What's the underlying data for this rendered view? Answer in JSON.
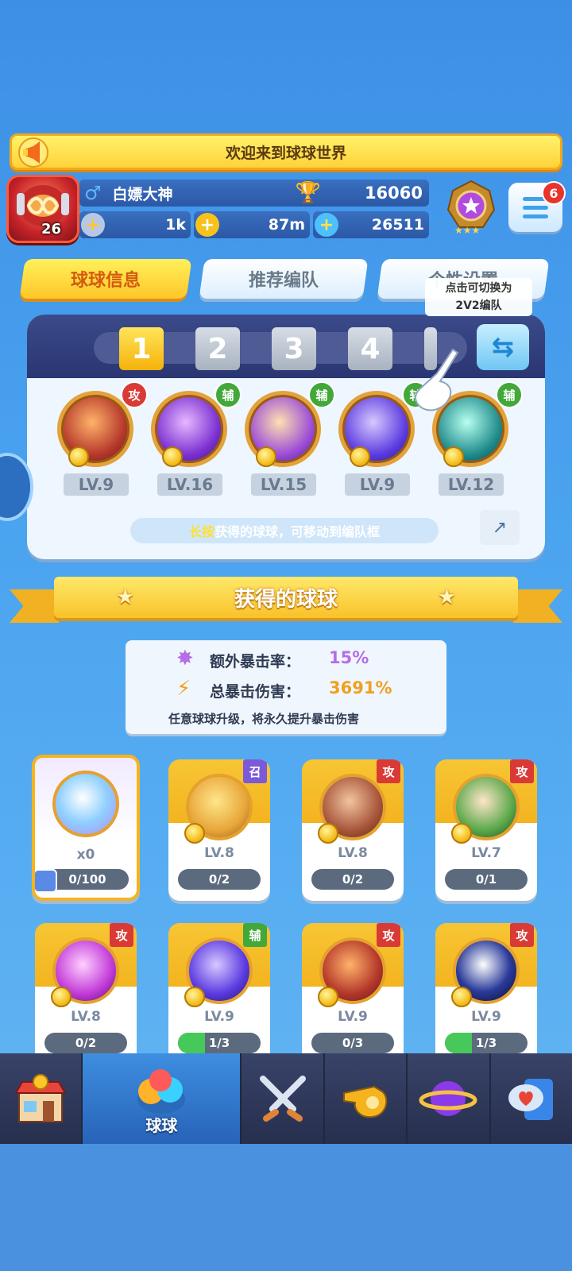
{
  "banner": {
    "text": "欢迎来到球球世界"
  },
  "player": {
    "level": "26",
    "name": "白嫖大神",
    "trophies": "16060",
    "energy": "1k",
    "coins": "87m",
    "gems": "26511",
    "notifications": "6"
  },
  "tabs": [
    {
      "label": "球球信息",
      "active": true
    },
    {
      "label": "推荐编队",
      "active": false
    },
    {
      "label": "个性设置",
      "active": false
    }
  ],
  "tooltip": {
    "line1": "点击可切换为",
    "line2": "2V2编队"
  },
  "team": {
    "slots": [
      "1",
      "2",
      "3",
      "4"
    ],
    "balls": [
      {
        "role": "攻",
        "level": "LV.9"
      },
      {
        "role": "辅",
        "level": "LV.16"
      },
      {
        "role": "辅",
        "level": "LV.15"
      },
      {
        "role": "辅",
        "level": "LV.9"
      },
      {
        "role": "辅",
        "level": "LV.12"
      }
    ],
    "hint_em": "长按",
    "hint_rest": "获得的球球，可移动到编队框"
  },
  "section": {
    "title": "获得的球球"
  },
  "crit": {
    "extra_label": "额外暴击率：",
    "extra_value": "15%",
    "total_label": "总暴击伤害：",
    "total_value": "3691%",
    "note": "任意球球升级，将永久提升暴击伤害"
  },
  "cards": [
    {
      "special": true,
      "count": "x0",
      "progress": "0/100"
    },
    {
      "role": "召",
      "level": "LV.8",
      "progress": "0/2"
    },
    {
      "role": "攻",
      "level": "LV.8",
      "progress": "0/2"
    },
    {
      "role": "攻",
      "level": "LV.7",
      "progress": "0/1"
    },
    {
      "role": "攻",
      "level": "LV.8",
      "progress": "0/2"
    },
    {
      "role": "辅",
      "level": "LV.9",
      "progress": "1/3"
    },
    {
      "role": "攻",
      "level": "LV.9",
      "progress": "0/3"
    },
    {
      "role": "攻",
      "level": "LV.9",
      "progress": "1/3"
    }
  ],
  "nav": {
    "active_label": "球球",
    "items": [
      "shop-icon",
      "balls-icon",
      "battle-swords-icon",
      "whistle-icon",
      "planet-icon",
      "chat-heart-icon"
    ]
  },
  "colors": {
    "attack": "#d93a36",
    "support": "#43a83a",
    "summon": "#7a5ad8",
    "accent": "#ffc62a"
  }
}
